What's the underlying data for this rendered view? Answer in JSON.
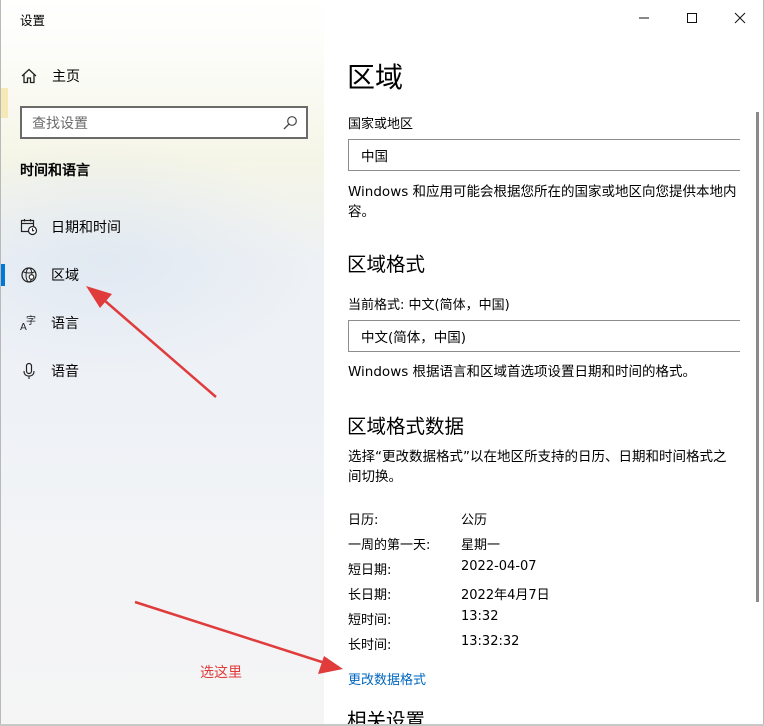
{
  "window": {
    "title": "设置"
  },
  "sidebar": {
    "home_label": "主页",
    "search_placeholder": "查找设置",
    "section_heading": "时间和语言",
    "items": [
      {
        "label": "日期和时间",
        "icon": "calendar-clock-icon",
        "active": false
      },
      {
        "label": "区域",
        "icon": "globe-icon",
        "active": true
      },
      {
        "label": "语言",
        "icon": "language-icon",
        "active": false
      },
      {
        "label": "语音",
        "icon": "microphone-icon",
        "active": false
      }
    ]
  },
  "main": {
    "title": "区域",
    "country_label": "国家或地区",
    "country_value": "中国",
    "country_desc": "Windows 和应用可能会根据您所在的国家或地区向您提供本地内容。",
    "format_heading": "区域格式",
    "current_format_label": "当前格式: 中文(简体，中国)",
    "format_value": "中文(简体，中国)",
    "format_desc": "Windows 根据语言和区域首选项设置日期和时间的格式。",
    "format_data_heading": "区域格式数据",
    "format_data_desc": "选择“更改数据格式”以在地区所支持的日历、日期和时间格式之间切换。",
    "format_data": [
      {
        "key": "日历:",
        "value": "公历"
      },
      {
        "key": "一周的第一天:",
        "value": "星期一"
      },
      {
        "key": "短日期:",
        "value": "2022-04-07"
      },
      {
        "key": "长日期:",
        "value": "2022年4月7日"
      },
      {
        "key": "短时间:",
        "value": "13:32"
      },
      {
        "key": "长时间:",
        "value": "13:32:32"
      }
    ],
    "change_format_link": "更改数据格式",
    "related_heading": "相关设置"
  },
  "annotation": {
    "label": "选这里",
    "color": "#e03c3c"
  },
  "colors": {
    "accent": "#0078d7",
    "link": "#0067c0"
  }
}
